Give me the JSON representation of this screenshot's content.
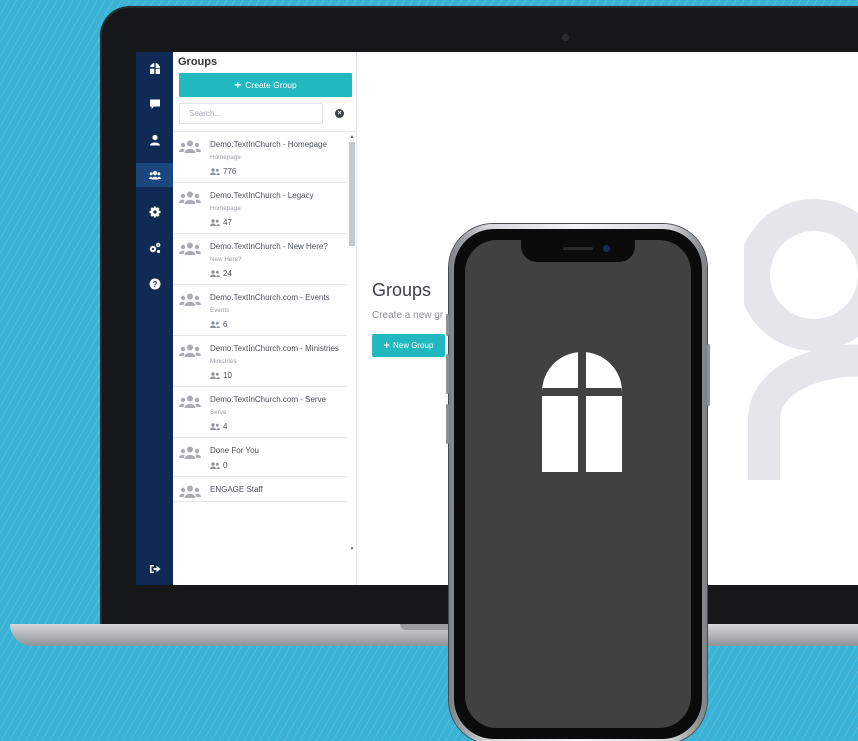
{
  "panel": {
    "title": "Groups",
    "create_label": "Create Group",
    "search_placeholder": "Search..."
  },
  "groups": [
    {
      "name": "Demo.TextInChurch - Homepage",
      "sub": "Homepage",
      "count": "776"
    },
    {
      "name": "Demo.TextInChurch - Legacy",
      "sub": "Homepage",
      "count": "47"
    },
    {
      "name": "Demo.TextInChurch - New Here?",
      "sub": "New Here?",
      "count": "24"
    },
    {
      "name": "Demo.TextInChurch.com - Events",
      "sub": "Events",
      "count": "6"
    },
    {
      "name": "Demo.TextInChurch.com - Ministries",
      "sub": "Ministries",
      "count": "10"
    },
    {
      "name": "Demo.TextInChurch.com - Serve",
      "sub": "Serve",
      "count": "4"
    },
    {
      "name": "Done For You",
      "sub": "",
      "count": "0"
    },
    {
      "name": "ENGAGE Staff",
      "sub": "",
      "count": ""
    }
  ],
  "main": {
    "title": "Groups",
    "subtitle": "Create a new gr",
    "new_group_label": "New Group"
  },
  "nav_icons": [
    "logo-icon",
    "chat-icon",
    "user-icon",
    "groups-icon",
    "settings-icon",
    "cogs-icon",
    "help-icon",
    "logout-icon"
  ],
  "colors": {
    "background": "#3ab3d6",
    "nav": "#0e2a55",
    "nav_active": "#1a477e",
    "accent": "#22b8bf",
    "phone_screen": "#414141"
  }
}
